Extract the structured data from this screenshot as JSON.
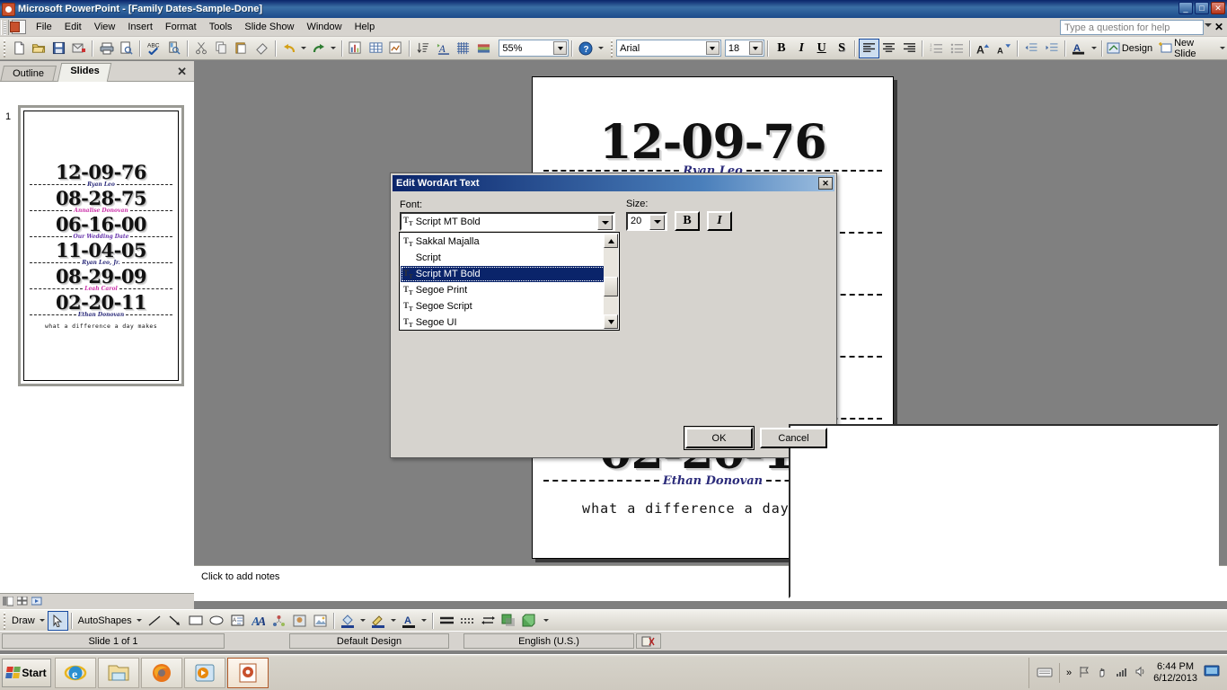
{
  "window": {
    "title": "Microsoft PowerPoint - [Family Dates-Sample-Done]",
    "minimize_label": "_",
    "maximize_label": "□",
    "close_label": "✕"
  },
  "menubar": {
    "items": [
      "File",
      "Edit",
      "View",
      "Insert",
      "Format",
      "Tools",
      "Slide Show",
      "Window",
      "Help"
    ],
    "help_placeholder": "Type a question for help",
    "close_label": "✕"
  },
  "toolbar": {
    "zoom_value": "55%",
    "font_name": "Arial",
    "font_size": "18",
    "bold_label": "B",
    "italic_label": "I",
    "underline_label": "U",
    "shadow_label": "S",
    "design_label": "Design",
    "new_slide_label": "New Slide",
    "icons": [
      "new-document-icon",
      "open-folder-icon",
      "save-icon",
      "email-icon",
      "print-icon",
      "print-preview-icon",
      "spell-check-icon",
      "research-icon",
      "cut-icon",
      "copy-icon",
      "paste-icon",
      "format-painter-icon",
      "undo-icon",
      "redo-icon",
      "insert-chart-icon",
      "insert-table-icon",
      "insert-diagram-icon",
      "animation-icon",
      "wordart-icon",
      "grid-icon",
      "colors-icon",
      "help-icon"
    ]
  },
  "left_panel": {
    "tabs": [
      "Outline",
      "Slides"
    ],
    "active_tab": "Slides",
    "close_label": "✕",
    "slide_number": "1"
  },
  "slide": {
    "entries": [
      {
        "date": "12-09-76",
        "caption": "Ryan Leo",
        "caption_color": "#2b2b7a"
      },
      {
        "date": "08-28-75",
        "caption": "Annalise Donovan",
        "caption_color": "#cc33aa"
      },
      {
        "date": "06-16-00",
        "caption": "Our Wedding Date",
        "caption_color": "#6633aa"
      },
      {
        "date": "11-04-05",
        "caption": "Ryan Leo, Jr.",
        "caption_color": "#2b2b7a"
      },
      {
        "date": "08-29-09",
        "caption": "Leah Carol",
        "caption_color": "#cc33aa"
      },
      {
        "date": "02-20-11",
        "caption": "Ethan Donovan",
        "caption_color": "#2b2b7a"
      }
    ],
    "footer": "what a difference a day makes"
  },
  "notes": {
    "placeholder": "Click to add notes"
  },
  "drawbar": {
    "draw_label": "Draw",
    "autoshapes_label": "AutoShapes",
    "icons": [
      "select-arrow-icon",
      "line-icon",
      "arrow-icon",
      "rectangle-icon",
      "oval-icon",
      "text-box-icon",
      "wordart-icon",
      "diagram-icon",
      "clip-art-icon",
      "picture-icon",
      "fill-color-icon",
      "line-color-icon",
      "font-color-icon",
      "line-style-icon",
      "dash-style-icon",
      "arrow-style-icon",
      "shadow-style-icon",
      "3d-style-icon"
    ]
  },
  "statusbar": {
    "slide_info": "Slide 1 of 1",
    "design": "Default Design",
    "language": "English (U.S.)",
    "spell_icon": "spell-status-icon"
  },
  "taskbar": {
    "start_label": "Start",
    "quick_launch": [
      "internet-explorer-icon",
      "file-explorer-icon",
      "firefox-icon",
      "media-player-icon",
      "powerpoint-icon"
    ],
    "tray_icons": [
      "show-hidden-icon",
      "flag-icon",
      "hand-icon",
      "network-icon",
      "volume-icon",
      "display-icon"
    ],
    "keyboard_icon": "keyboard-icon",
    "time": "6:44 PM",
    "date": "6/12/2013"
  },
  "dialog": {
    "title": "Edit WordArt Text",
    "close_label": "✕",
    "font_label": "Font:",
    "size_label": "Size:",
    "font_value": "Script MT Bold",
    "size_value": "20",
    "bold_label": "B",
    "italic_label": "I",
    "text_value": "",
    "ok_label": "OK",
    "cancel_label": "Cancel",
    "font_options": [
      {
        "name": "Sakkal Majalla",
        "truetype": true
      },
      {
        "name": "Script",
        "truetype": false
      },
      {
        "name": "Script MT Bold",
        "truetype": true
      },
      {
        "name": "Segoe Print",
        "truetype": true
      },
      {
        "name": "Segoe Script",
        "truetype": true
      },
      {
        "name": "Segoe UI",
        "truetype": true
      }
    ],
    "selected_option_index": 2
  }
}
